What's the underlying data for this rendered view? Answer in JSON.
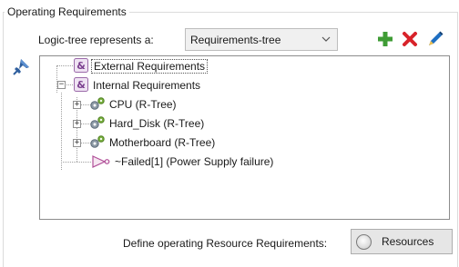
{
  "group": {
    "title": "Operating Requirements"
  },
  "logic": {
    "label": "Logic-tree represents a:",
    "selected": "Requirements-tree"
  },
  "toolbar": {
    "add_icon": "plus-icon",
    "delete_icon": "delete-x-icon",
    "edit_icon": "pencil-icon",
    "colors": {
      "add": "#3f9c35",
      "delete": "#d8232a",
      "edit": "#1e6fc2"
    }
  },
  "tree": {
    "nodes": [
      {
        "label": "External Requirements",
        "icon": "and-gate-icon"
      },
      {
        "label": "Internal Requirements",
        "icon": "and-gate-icon"
      },
      {
        "label": "CPU (R-Tree)",
        "icon": "gears-icon"
      },
      {
        "label": "Hard_Disk (R-Tree)",
        "icon": "gears-icon"
      },
      {
        "label": "Motherboard (R-Tree)",
        "icon": "gears-icon"
      },
      {
        "label": "~Failed[1]  (Power Supply failure)",
        "icon": "not-gate-icon"
      }
    ]
  },
  "footer": {
    "define_label": "Define operating Resource Requirements:",
    "resources_button": "Resources"
  }
}
